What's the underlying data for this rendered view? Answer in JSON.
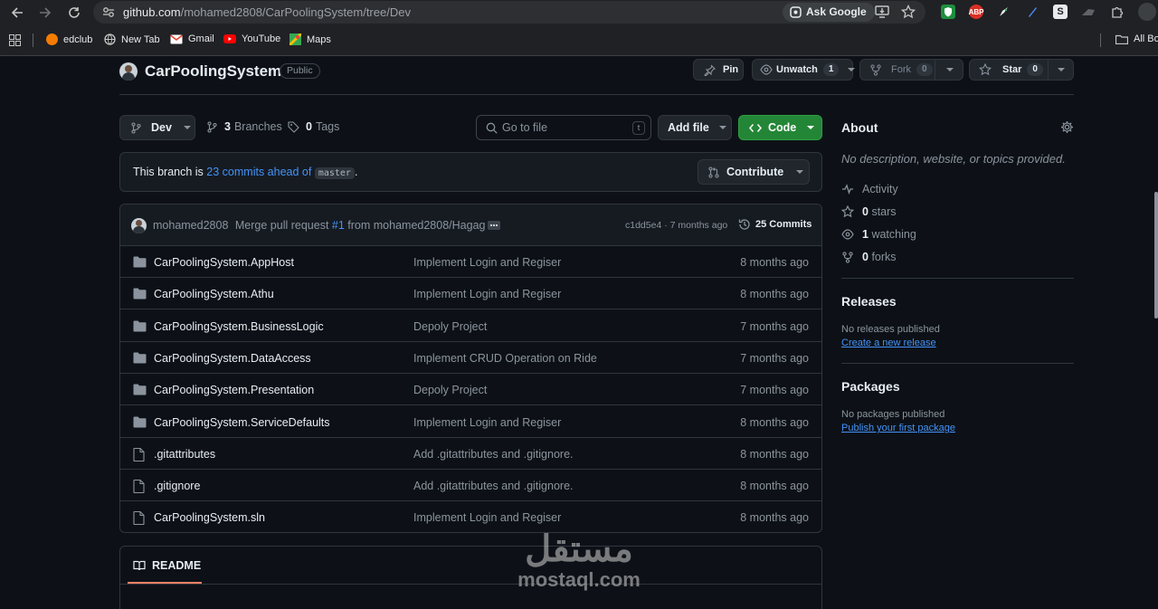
{
  "browser": {
    "url_host": "github.com",
    "url_path": "/mohamed2808/CarPoolingSystem/tree/Dev",
    "ask_google": "Ask Google",
    "extensions": [
      "ABP",
      "S"
    ],
    "bookmarks": [
      {
        "label": "edclub",
        "icon": "edclub-icon",
        "color": "#f57c00"
      },
      {
        "label": "New Tab",
        "icon": "globe-icon",
        "color": "#9aa0a6"
      },
      {
        "label": "Gmail",
        "icon": "gmail-icon",
        "color": "#ea4335"
      },
      {
        "label": "YouTube",
        "icon": "youtube-icon",
        "color": "#ff0000"
      },
      {
        "label": "Maps",
        "icon": "maps-icon",
        "color": "#34a853"
      }
    ],
    "all_bookmarks": "All Bo"
  },
  "repo": {
    "name": "CarPoolingSystem",
    "visibility": "Public",
    "pin_label": "Pin",
    "unwatch_label": "Unwatch",
    "unwatch_count": "1",
    "fork_label": "Fork",
    "fork_count": "0",
    "star_label": "Star",
    "star_count": "0"
  },
  "toolbar": {
    "branch": "Dev",
    "branches_count": "3",
    "branches_label": "Branches",
    "tags_count": "0",
    "tags_label": "Tags",
    "search_placeholder": "Go to file",
    "search_shortcut": "t",
    "add_file_label": "Add file",
    "code_label": "Code"
  },
  "branch_notice": {
    "prefix": "This branch is",
    "link": "23 commits ahead of",
    "base": "master",
    "suffix": ".",
    "contribute_label": "Contribute"
  },
  "latest_commit": {
    "author": "mohamed2808",
    "message_prefix": "Merge pull request",
    "pr": "#1",
    "message_suffix": "from mohamed2808/Hagag",
    "sha_time": "c1dd5e4 · 7 months ago",
    "commits_label": "25 Commits"
  },
  "files": [
    {
      "type": "folder",
      "name": "CarPoolingSystem.AppHost",
      "message": "Implement Login and Regiser",
      "date": "8 months ago"
    },
    {
      "type": "folder",
      "name": "CarPoolingSystem.Athu",
      "message": "Implement Login and Regiser",
      "date": "8 months ago"
    },
    {
      "type": "folder",
      "name": "CarPoolingSystem.BusinessLogic",
      "message": "Depoly Project",
      "date": "7 months ago"
    },
    {
      "type": "folder",
      "name": "CarPoolingSystem.DataAccess",
      "message": "Implement CRUD Operation on Ride",
      "date": "7 months ago"
    },
    {
      "type": "folder",
      "name": "CarPoolingSystem.Presentation",
      "message": "Depoly Project",
      "date": "7 months ago"
    },
    {
      "type": "folder",
      "name": "CarPoolingSystem.ServiceDefaults",
      "message": "Implement Login and Regiser",
      "date": "8 months ago"
    },
    {
      "type": "file",
      "name": ".gitattributes",
      "message": "Add .gitattributes and .gitignore.",
      "date": "8 months ago"
    },
    {
      "type": "file",
      "name": ".gitignore",
      "message": "Add .gitattributes and .gitignore.",
      "date": "8 months ago"
    },
    {
      "type": "file",
      "name": "CarPoolingSystem.sln",
      "message": "Implement Login and Regiser",
      "date": "8 months ago"
    }
  ],
  "readme": {
    "tab_label": "README"
  },
  "about": {
    "title": "About",
    "description": "No description, website, or topics provided.",
    "activity_label": "Activity",
    "stars_count": "0",
    "stars_label": "stars",
    "watching_count": "1",
    "watching_label": "watching",
    "forks_count": "0",
    "forks_label": "forks"
  },
  "releases": {
    "title": "Releases",
    "empty": "No releases published",
    "create_link": "Create a new release"
  },
  "packages": {
    "title": "Packages",
    "empty": "No packages published",
    "publish_link": "Publish your first package"
  },
  "watermark": {
    "arabic": "مستقل",
    "latin": "mostaql.com"
  }
}
